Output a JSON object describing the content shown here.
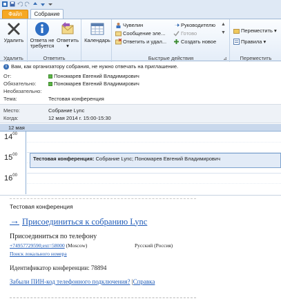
{
  "tabs": {
    "file": "Файл",
    "meeting": "Собрание"
  },
  "ribbon": {
    "groups": {
      "delete": "Удалить",
      "respond": "Ответить",
      "quick_steps": "Быстрые действия",
      "move": "Переместить"
    },
    "buttons": {
      "delete": "Удалить",
      "no_response_line1": "Ответа не",
      "no_response_line2": "требуется",
      "reply_line1": "Ответить",
      "reply_line2": "",
      "calendar": "Календарь",
      "qs_chuvelin": "Чувелин",
      "qs_manager": "Руководителю",
      "qs_email": "Сообщение эле...",
      "qs_done": "Готово",
      "qs_reply_delete": "Ответить и удал...",
      "qs_create_new": "Создать новое",
      "move": "Переместить",
      "rules": "Правила"
    }
  },
  "info": {
    "message": "Вам, как организатору собрания, не нужно отвечать на приглашение."
  },
  "header": {
    "from_label": "От:",
    "from_value": "Пономарев Евгений Владимирович",
    "required_label": "Обязательно:",
    "required_value": "Пономарев Евгений Владимирович",
    "optional_label": "Необязательно:",
    "optional_value": "",
    "subject_label": "Тема:",
    "subject_value": "Тестовая конференция",
    "location_label": "Место:",
    "location_value": "Собрание Lync",
    "when_label": "Когда:",
    "when_value": "12 мая 2014 г. 15:00-15:30"
  },
  "calendar": {
    "date": "12 мая",
    "hours": [
      {
        "h": "14",
        "m": "00"
      },
      {
        "h": "15",
        "m": "00"
      },
      {
        "h": "16",
        "m": "00"
      }
    ],
    "appointment_bold": "Тестовая конференция:",
    "appointment_rest": " Собрание Lync; Пономарев Евгений Владимирович"
  },
  "body": {
    "title": "Тестовая конференция",
    "join_arrow": "→",
    "join_link": "Присоединиться к собранию Lync",
    "phone_heading": "Присоединиться по телефону",
    "phone_number": "+74957729590;ext=58000",
    "phone_city": " (Moscow)",
    "phone_region": "Русский (Россия)",
    "local_number": "Поиск локального номера",
    "conference_id": "Идентификатор конференции: 78894",
    "pin_link": "Забыли ПИН-код телефонного подключения?",
    "pin_sep": " |",
    "help_link": "Справка"
  },
  "colors": {
    "accent_file": "#f6a823",
    "link": "#1f5bb8",
    "ribbon_border": "#9fb7d4",
    "presence": "#5cb545"
  }
}
